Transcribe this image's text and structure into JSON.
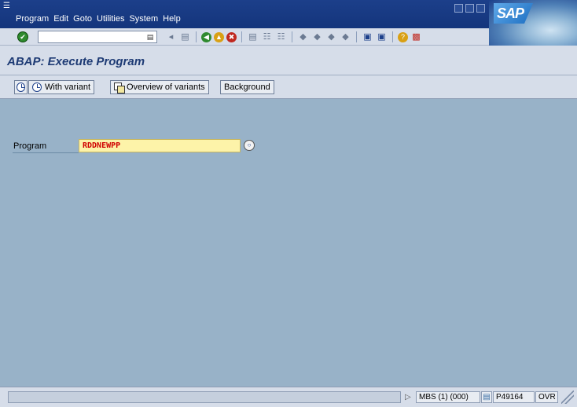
{
  "window": {
    "menu": [
      {
        "label": "Program"
      },
      {
        "label": "Edit"
      },
      {
        "label": "Goto"
      },
      {
        "label": "Utilities"
      },
      {
        "label": "System"
      },
      {
        "label": "Help"
      }
    ],
    "logo_text": "SAP"
  },
  "toolbar": {
    "command_field_value": "",
    "icons": [
      "enter-icon",
      "save-icon",
      "back-icon",
      "exit-icon",
      "cancel-icon",
      "print-icon",
      "find-icon",
      "find-next-icon",
      "first-page-icon",
      "previous-page-icon",
      "next-page-icon",
      "last-page-icon",
      "create-session-icon",
      "shortcut-icon",
      "help-icon",
      "layout-icon"
    ]
  },
  "title": {
    "text": "ABAP: Execute Program"
  },
  "app_toolbar": {
    "execute_label": "",
    "with_variant_label": "With variant",
    "overview_label": "Overview of variants",
    "background_label": "Background"
  },
  "form": {
    "program_label": "Program",
    "program_value": "RDDNEWPP"
  },
  "status": {
    "message": "",
    "system": "MBS (1) (000)",
    "server": "P49164",
    "mode": "OVR"
  },
  "colors": {
    "menubar": "#1c3f8a",
    "toolbar": "#d6dde9",
    "main_bg": "#98b2c8",
    "input_bg": "#fdf3a9",
    "input_text": "#d00000",
    "title_text": "#1d3a74"
  }
}
